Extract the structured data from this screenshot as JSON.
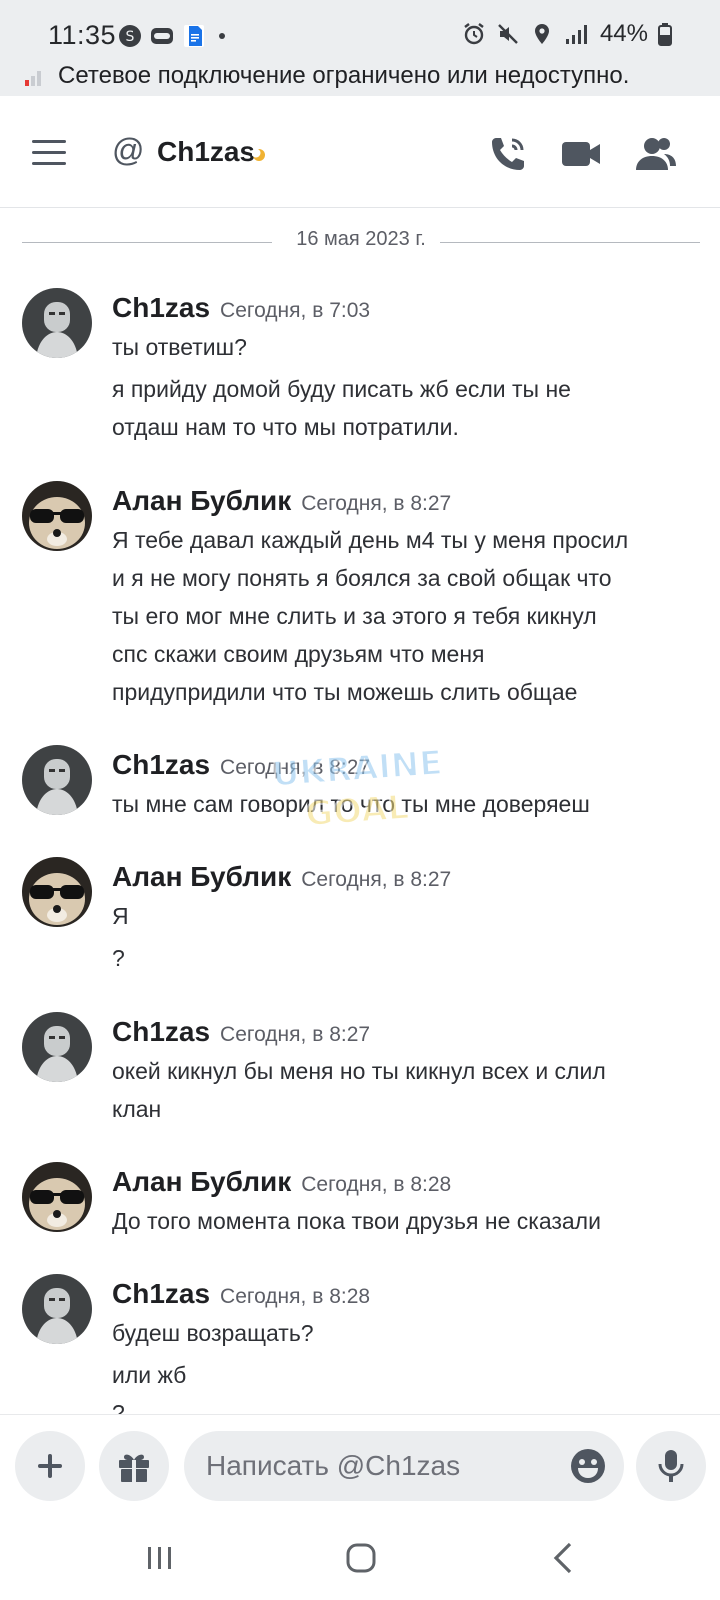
{
  "status_bar": {
    "time": "11:35",
    "battery": "44%",
    "notice": "Сетевое подключение ограничено или недоступно."
  },
  "header": {
    "channel_name": "Ch1zas",
    "icons": [
      "menu-icon",
      "at-icon",
      "phone-call-icon",
      "video-call-icon",
      "members-icon"
    ]
  },
  "date_divider": "16 мая 2023 г.",
  "messages": [
    {
      "author": "Ch1zas",
      "time": "Сегодня, в 7:03",
      "lines": [
        "ты ответиш?",
        "я прийду домой буду писать жб если ты не",
        "отдаш нам то что мы потратили."
      ]
    },
    {
      "author": "Алан Бублик",
      "time": "Сегодня, в 8:27",
      "lines": [
        "Я тебе давал каждый день м4 ты у меня просил",
        "и я не могу понять я боялся за свой общак что",
        "ты его мог мне слить и за этого я тебя кикнул",
        "спс скажи своим друзьям что меня",
        "придупридили что ты можешь слить общае"
      ]
    },
    {
      "author": "Ch1zas",
      "time": "Сегодня, в 8:27",
      "lines": [
        "ты мне сам говорил то что ты мне доверяеш"
      ]
    },
    {
      "author": "Алан Бублик",
      "time": "Сегодня, в 8:27",
      "lines": [
        "Я",
        "?"
      ]
    },
    {
      "author": "Ch1zas",
      "time": "Сегодня, в 8:27",
      "lines": [
        "окей кикнул бы меня но ты кикнул всех и слил",
        "клан"
      ]
    },
    {
      "author": "Алан Бублик",
      "time": "Сегодня, в 8:28",
      "lines": [
        "До того момента пока твои друзья не сказали"
      ]
    },
    {
      "author": "Ch1zas",
      "time": "Сегодня, в 8:28",
      "lines": [
        "будеш возращать?",
        "или жб",
        "?"
      ]
    }
  ],
  "composer": {
    "placeholder": "Написать @Ch1zas"
  },
  "watermark": {
    "line1": "UKRAINE",
    "line2": "GOAL"
  },
  "colors": {
    "status_bg": "#eceef0",
    "idle_moon": "#f0b232",
    "text_primary": "#1f2023",
    "text_muted": "#5c5e66",
    "pill_bg": "#ebedef"
  }
}
